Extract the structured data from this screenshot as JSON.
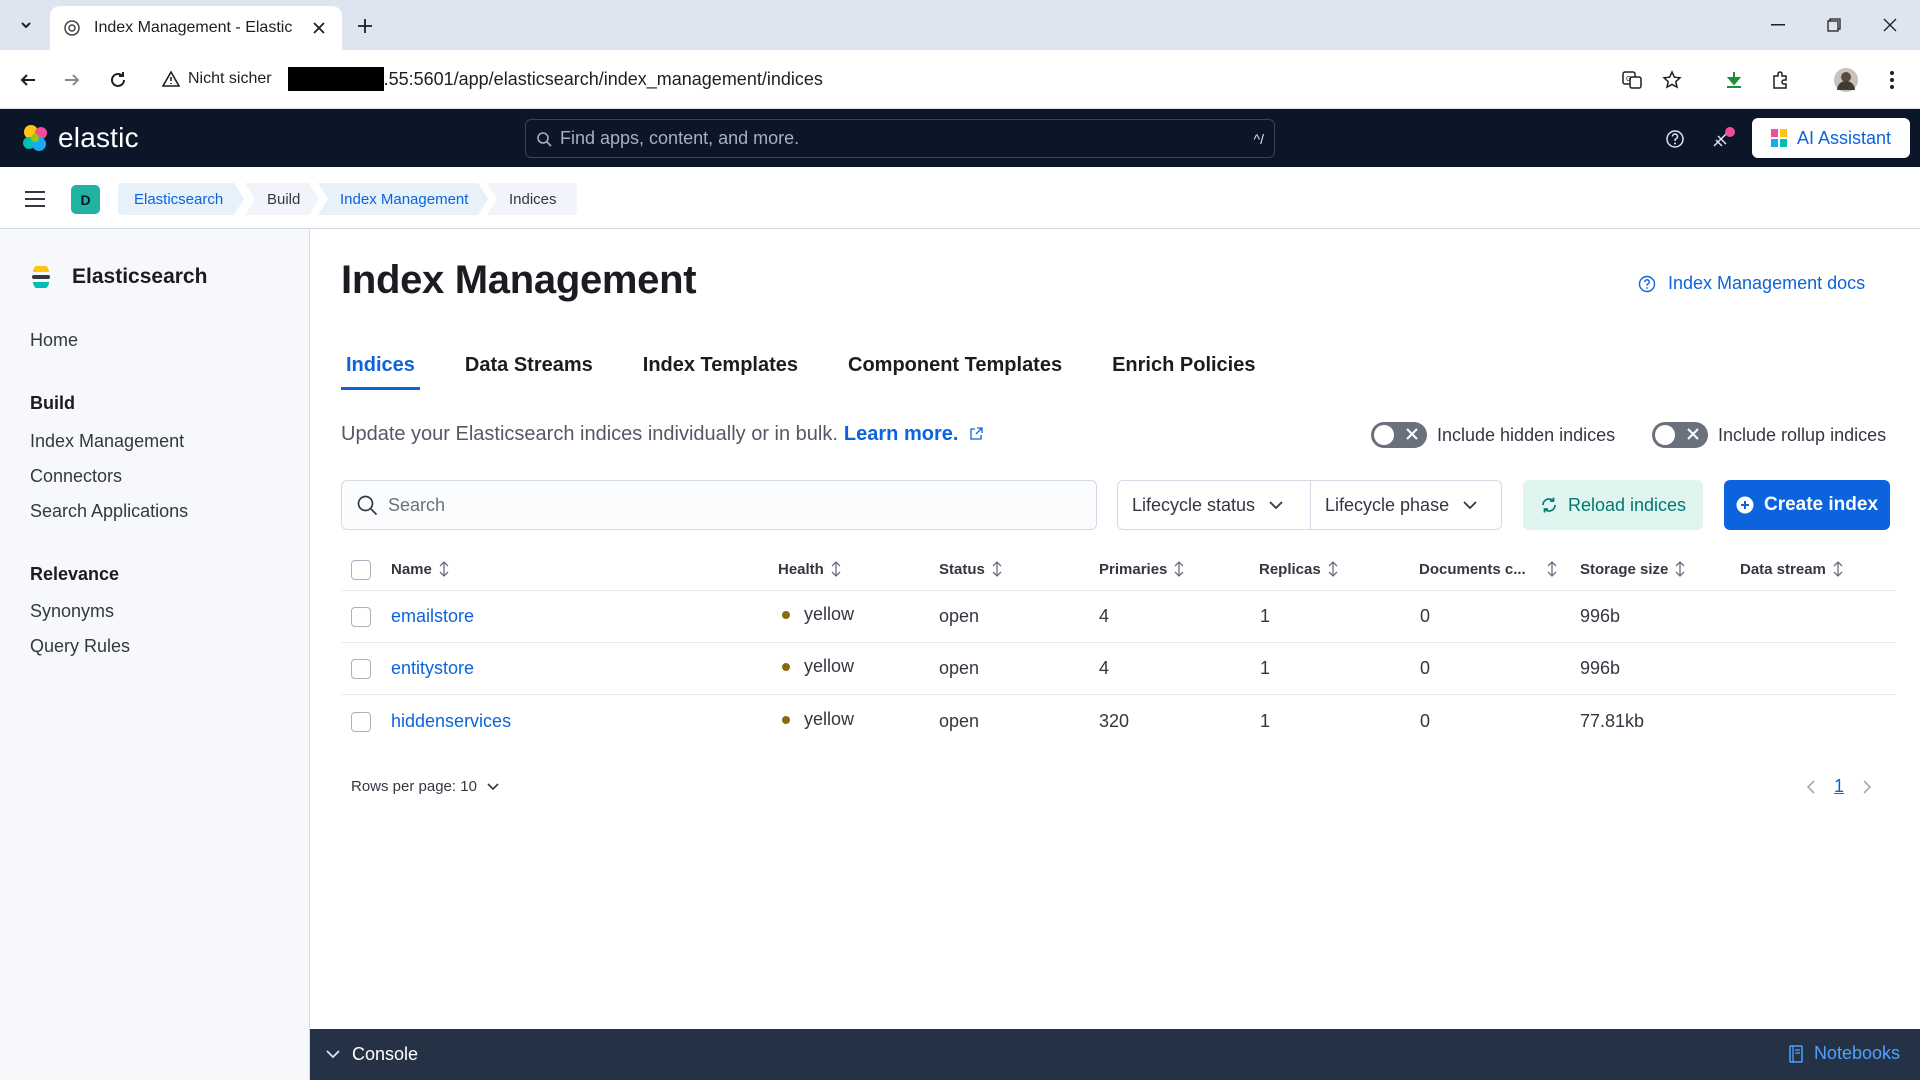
{
  "browser": {
    "tab_title": "Index Management - Elastic",
    "security_label": "Nicht sicher",
    "url": ".55:5601/app/elasticsearch/index_management/indices"
  },
  "header": {
    "brand": "elastic",
    "search_placeholder": "Find apps, content, and more.",
    "search_shortcut": "^/",
    "ai_assistant_label": "AI Assistant"
  },
  "breadcrumbs": {
    "space_initial": "D",
    "items": [
      "Elasticsearch",
      "Build",
      "Index Management",
      "Indices"
    ]
  },
  "sidebar": {
    "title": "Elasticsearch",
    "home": "Home",
    "build_group": "Build",
    "build_items": [
      "Index Management",
      "Connectors",
      "Search Applications"
    ],
    "relevance_group": "Relevance",
    "relevance_items": [
      "Synonyms",
      "Query Rules"
    ]
  },
  "main": {
    "title": "Index Management",
    "docs_link": "Index Management docs",
    "tabs": [
      "Indices",
      "Data Streams",
      "Index Templates",
      "Component Templates",
      "Enrich Policies"
    ],
    "active_tab": "Indices",
    "description": "Update your Elasticsearch indices individually or in bulk.",
    "learn_more": "Learn more.",
    "toggle_hidden": "Include hidden indices",
    "toggle_rollup": "Include rollup indices",
    "search_placeholder": "Search",
    "filter_lifecycle_status": "Lifecycle status",
    "filter_lifecycle_phase": "Lifecycle phase",
    "reload_label": "Reload indices",
    "create_label": "Create index"
  },
  "table": {
    "columns": [
      "Name",
      "Health",
      "Status",
      "Primaries",
      "Replicas",
      "Documents c...",
      "Storage size",
      "Data stream"
    ],
    "rows": [
      {
        "name": "emailstore",
        "health": "yellow",
        "status": "open",
        "primaries": "4",
        "replicas": "1",
        "documents": "0",
        "storage": "996b",
        "data_stream": ""
      },
      {
        "name": "entitystore",
        "health": "yellow",
        "status": "open",
        "primaries": "4",
        "replicas": "1",
        "documents": "0",
        "storage": "996b",
        "data_stream": ""
      },
      {
        "name": "hiddenservices",
        "health": "yellow",
        "status": "open",
        "primaries": "320",
        "replicas": "1",
        "documents": "0",
        "storage": "77.81kb",
        "data_stream": ""
      }
    ],
    "rows_per_page_label": "Rows per page: 10",
    "current_page": "1"
  },
  "footer": {
    "console_label": "Console",
    "notebooks_label": "Notebooks"
  },
  "colors": {
    "accent": "#0b64dd",
    "header_bg": "#0b1628",
    "health_yellow": "#8a6a0a"
  }
}
